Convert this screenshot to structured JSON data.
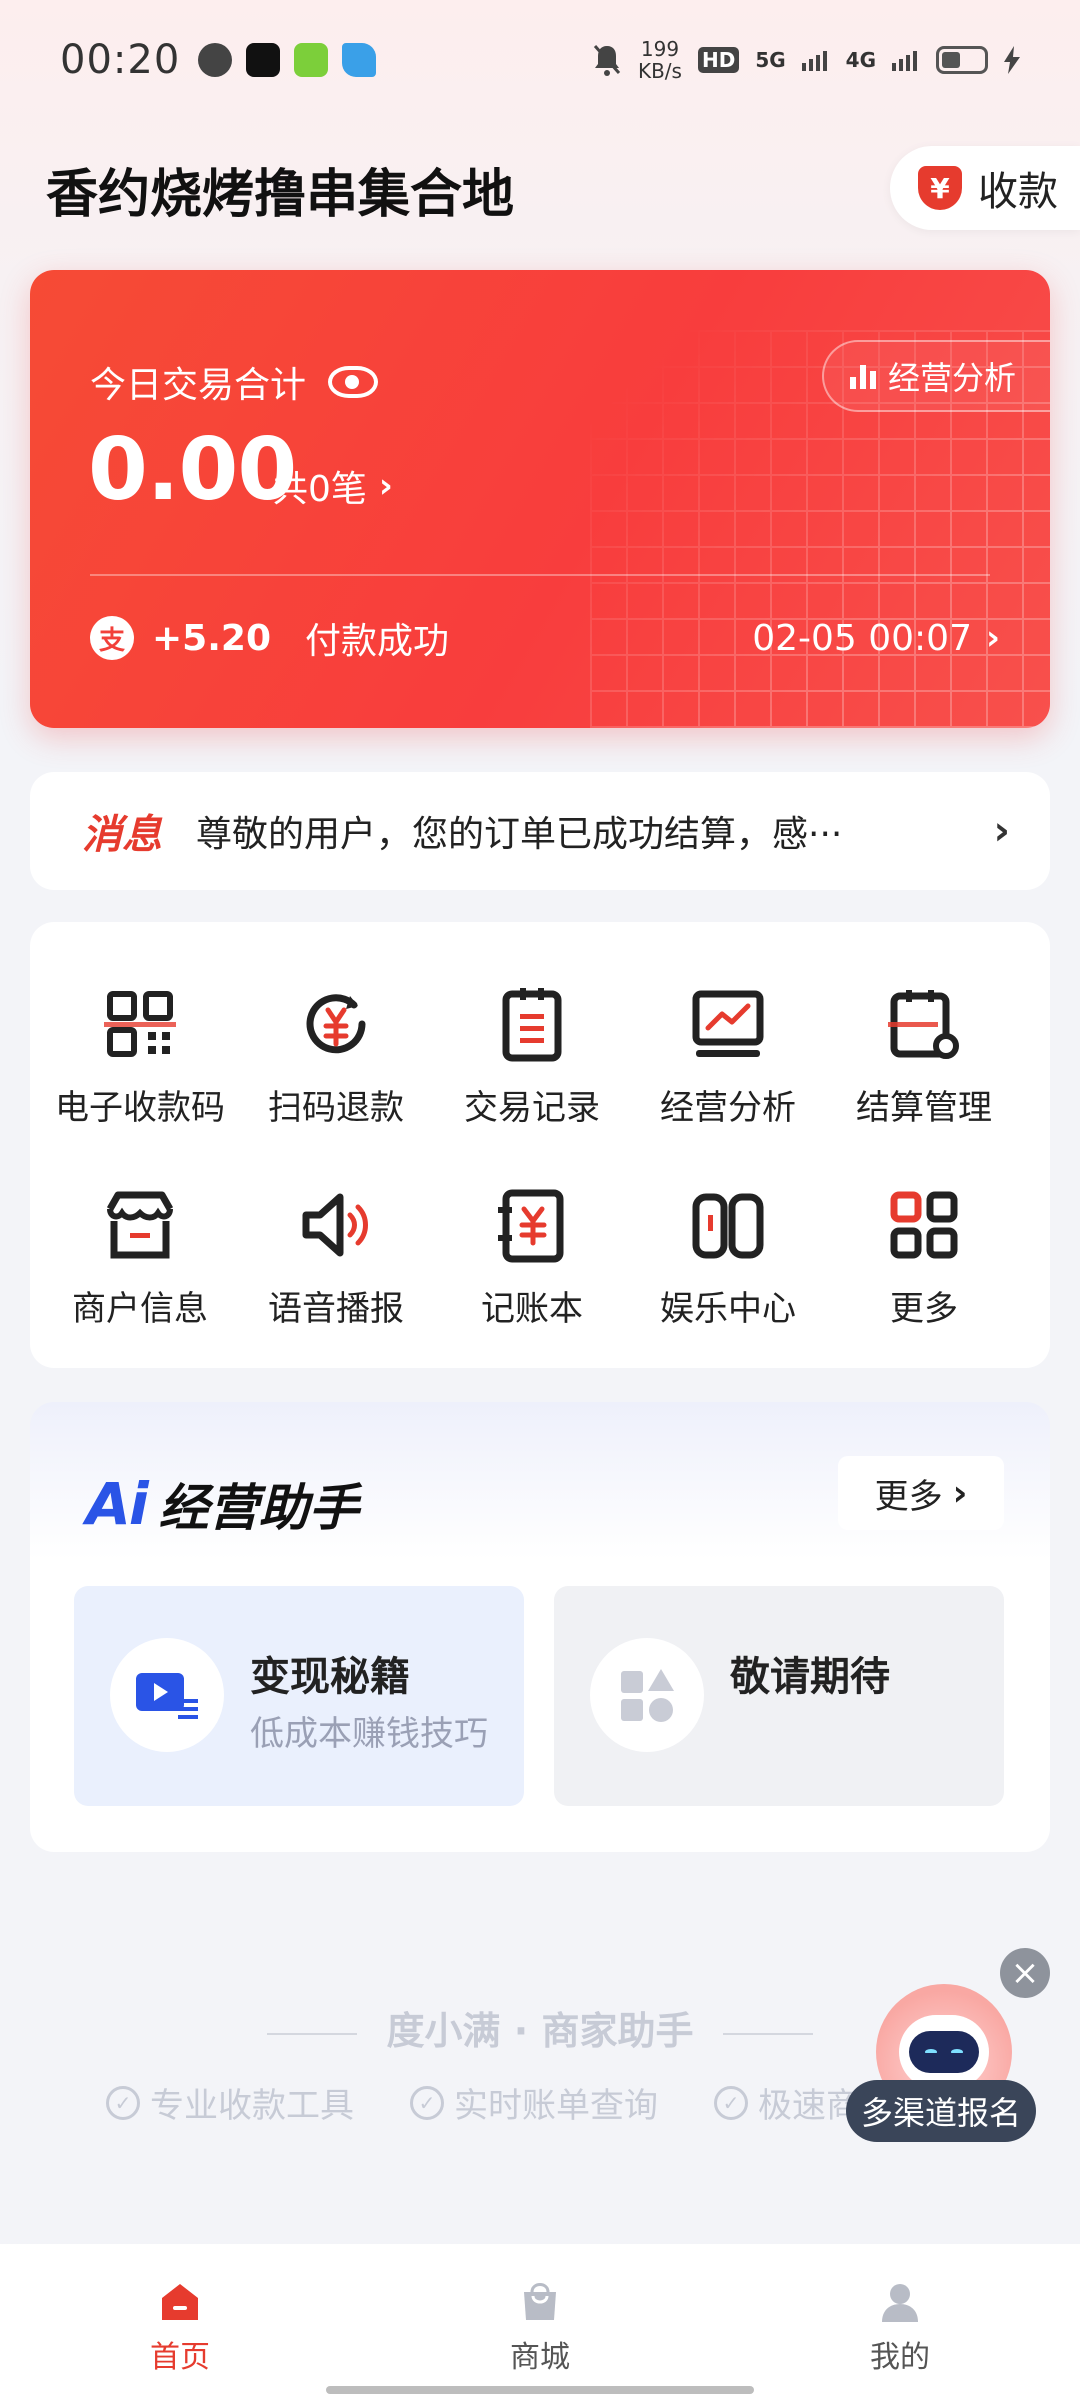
{
  "status_bar": {
    "time": "00:20",
    "speed_value": "199",
    "speed_unit": "KB/s",
    "net_1": "HD",
    "net_2": "5G",
    "net_3": "4G"
  },
  "header": {
    "store_name": "香约烧烤撸串集合地",
    "collect_label": "收款",
    "collect_icon_glyph": "¥"
  },
  "summary_card": {
    "title": "今日交易合计",
    "analysis_label": "经营分析",
    "amount": "0.00",
    "count_text": "共0笔",
    "last_txn": {
      "icon_glyph": "支",
      "amount": "+5.20",
      "status": "付款成功",
      "time": "02-05 00:07"
    }
  },
  "message": {
    "tag": "消息",
    "text": "尊敬的用户，您的订单已成功结算，感···"
  },
  "functions": [
    {
      "label": "电子收款码",
      "icon": "qr-code-icon"
    },
    {
      "label": "扫码退款",
      "icon": "refund-icon"
    },
    {
      "label": "交易记录",
      "icon": "transaction-record-icon"
    },
    {
      "label": "经营分析",
      "icon": "business-analysis-icon"
    },
    {
      "label": "结算管理",
      "icon": "settlement-icon"
    },
    {
      "label": "商户信息",
      "icon": "store-icon"
    },
    {
      "label": "语音播报",
      "icon": "speaker-icon"
    },
    {
      "label": "记账本",
      "icon": "ledger-icon"
    },
    {
      "label": "娱乐中心",
      "icon": "game-console-icon"
    },
    {
      "label": "更多",
      "icon": "more-grid-icon"
    }
  ],
  "ai_assistant": {
    "badge": "Ai",
    "title": "经营助手",
    "more_label": "更多",
    "cards": [
      {
        "title": "变现秘籍",
        "desc": "低成本赚钱技巧",
        "icon": "video-icon"
      },
      {
        "title": "敬请期待",
        "desc": "",
        "icon": "shapes-icon"
      }
    ]
  },
  "footer": {
    "brand": "度小满 · 商家助手",
    "features": [
      "专业收款工具",
      "实时账单查询",
      "极速商"
    ]
  },
  "floating_bot": {
    "label": "多渠道报名"
  },
  "tabs": [
    {
      "label": "首页",
      "icon": "home-icon",
      "active": true
    },
    {
      "label": "商城",
      "icon": "shopping-bag-icon",
      "active": false
    },
    {
      "label": "我的",
      "icon": "profile-icon",
      "active": false
    }
  ],
  "colors": {
    "accent": "#e63b2e",
    "card_red": "#f8443d",
    "ai_blue": "#2a54e6"
  }
}
